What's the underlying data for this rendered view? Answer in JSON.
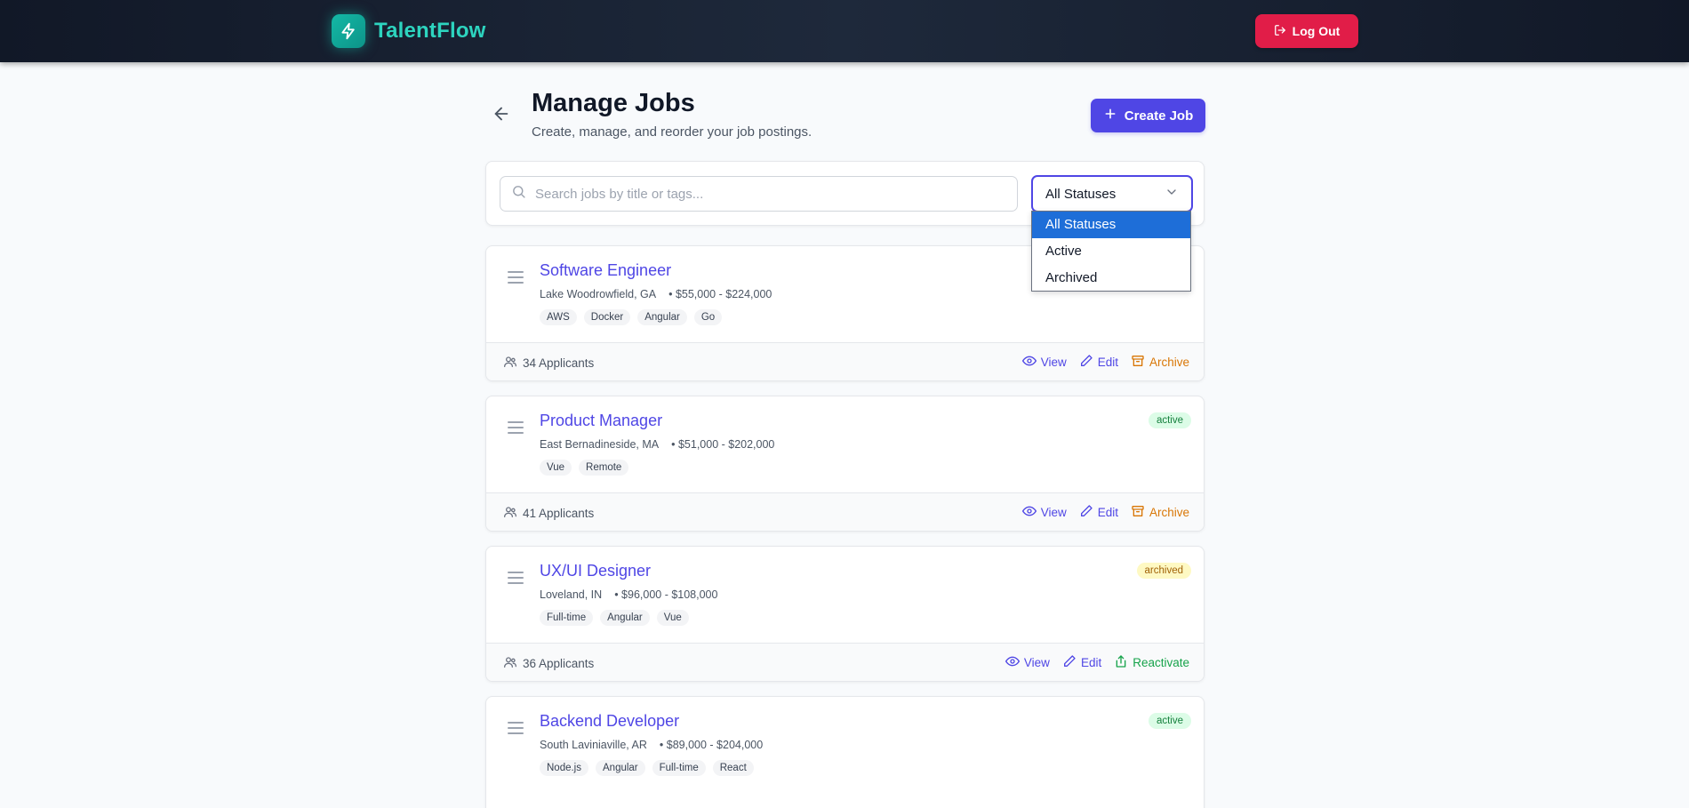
{
  "app": {
    "brand_name": "TalentFlow",
    "logout_label": "Log Out"
  },
  "header": {
    "title": "Manage Jobs",
    "subtitle": "Create, manage, and reorder your job postings.",
    "create_label": "Create Job"
  },
  "filters": {
    "search_placeholder": "Search jobs by title or tags...",
    "search_value": "",
    "status_selected": "All Statuses",
    "status_options": [
      "All Statuses",
      "Active",
      "Archived"
    ]
  },
  "jobs": [
    {
      "title": "Software Engineer",
      "location": "Lake Woodrowfield, GA",
      "salary": "• $55,000 - $224,000",
      "tags": [
        "AWS",
        "Docker",
        "Angular",
        "Go"
      ],
      "status": "",
      "applicants": "34 Applicants",
      "actions": [
        "View",
        "Edit",
        "Archive"
      ]
    },
    {
      "title": "Product Manager",
      "location": "East Bernadineside, MA",
      "salary": "• $51,000 - $202,000",
      "tags": [
        "Vue",
        "Remote"
      ],
      "status": "active",
      "applicants": "41 Applicants",
      "actions": [
        "View",
        "Edit",
        "Archive"
      ]
    },
    {
      "title": "UX/UI Designer",
      "location": "Loveland, IN",
      "salary": "• $96,000 - $108,000",
      "tags": [
        "Full-time",
        "Angular",
        "Vue"
      ],
      "status": "archived",
      "applicants": "36 Applicants",
      "actions": [
        "View",
        "Edit",
        "Reactivate"
      ]
    },
    {
      "title": "Backend Developer",
      "location": "South Laviniaville, AR",
      "salary": "• $89,000 - $204,000",
      "tags": [
        "Node.js",
        "Angular",
        "Full-time",
        "React"
      ],
      "status": "active",
      "applicants": "",
      "actions": []
    }
  ],
  "colors": {
    "accent": "#4f46e5",
    "brand": "#2dd4bf",
    "danger": "#e11d48",
    "archive": "#d97706",
    "reactivate": "#16a34a"
  },
  "icons": {
    "brand": "bolt-icon",
    "logout": "logout-icon",
    "back": "arrow-left-icon",
    "create": "plus-icon",
    "search": "search-icon",
    "select": "chevron-down-icon",
    "drag": "drag-handle-icon",
    "applicants": "users-icon",
    "view": "eye-icon",
    "edit": "pencil-icon",
    "archive": "archive-box-icon",
    "reactivate": "share-up-icon"
  }
}
